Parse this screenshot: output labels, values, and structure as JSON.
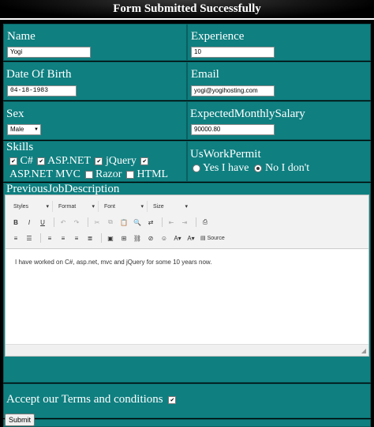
{
  "header": {
    "title": "Form Submitted Successfully"
  },
  "fields": {
    "name": {
      "label": "Name",
      "value": "Yogi"
    },
    "experience": {
      "label": "Experience",
      "value": "10"
    },
    "dob": {
      "label": "Date Of Birth",
      "value": "04-18-1983"
    },
    "email": {
      "label": "Email",
      "value": "yogi@yogihosting.com"
    },
    "sex": {
      "label": "Sex",
      "value": "Male"
    },
    "salary": {
      "label": "ExpectedMonthlySalary",
      "value": "90000.80"
    },
    "skills": {
      "label": "Skills",
      "options": [
        "C#",
        "ASP.NET",
        "jQuery",
        "ASP.NET MVC",
        "Razor",
        "HTML"
      ]
    },
    "work_permit": {
      "label": "UsWorkPermit",
      "yes": "Yes I have",
      "no": "No I don't",
      "selected": "no"
    },
    "job_description": {
      "label": "PreviousJobDescription",
      "content": "I have worked on C#, asp.net, mvc and jQuery for some 10 years now."
    },
    "terms": {
      "label": "Accept our Terms and conditions"
    }
  },
  "editor": {
    "styles_label": "Styles",
    "format_label": "Format",
    "font_label": "Font",
    "size_label": "Size",
    "source_label": "Source"
  },
  "submit": {
    "label": "Submit"
  },
  "colors": {
    "cell_bg": "#0f7f80",
    "page_bg": "#000000"
  }
}
